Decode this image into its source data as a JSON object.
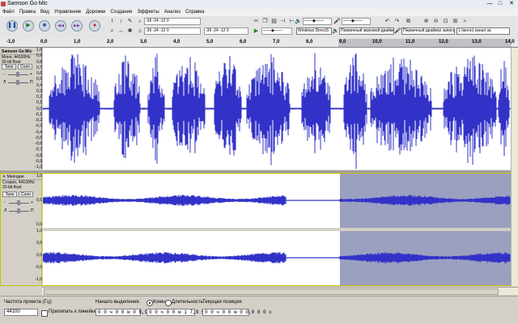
{
  "window": {
    "title": "Samson Go Mic",
    "minimize": "—",
    "maximize": "□",
    "close": "✕"
  },
  "menu": [
    "Файл",
    "Правка",
    "Вид",
    "Управление",
    "Дорожки",
    "Создание",
    "Эффекты",
    "Анализ",
    "Справка"
  ],
  "toolbar": {
    "pause": "❚❚",
    "play": "▶",
    "stop": "■",
    "skip_start": "◀◀",
    "skip_end": "▶▶",
    "record": "●",
    "meter_left_ticks": "-36  -24  -12   0",
    "meter_right_ticks": "-36  -24  -12   0",
    "host": "Windows DirectS",
    "output_device": "Первичный звуковой драйве",
    "input_device": "Первичный драйвер записи",
    "channels": "1 (моно) канал за"
  },
  "ruler": {
    "ticks": [
      "-1,0",
      "0,0",
      "1,0",
      "2,0",
      "3,0",
      "4,0",
      "5,0",
      "6,0",
      "7,0",
      "8,0",
      "9,0",
      "10,0",
      "11,0",
      "12,0",
      "13,0",
      "14,0"
    ]
  },
  "track1": {
    "name": "Samson Go Mic",
    "info1": "Моно, 44100Hz",
    "info2": "32-bit float",
    "mute": "Тихо",
    "solo": "Соло",
    "gain_minus": "-",
    "gain_plus": "+",
    "pan_left": "Л",
    "pan_right": "П",
    "scale": [
      "1,0",
      "0,9",
      "0,8",
      "0,7",
      "0,6",
      "0,5",
      "0,4",
      "0,3",
      "0,2",
      "0,1",
      "0,0",
      "-0,1",
      "-0,2",
      "-0,3",
      "-0,4",
      "-0,5",
      "-0,6",
      "-0,7",
      "-0,8",
      "-0,9",
      "-1,0"
    ]
  },
  "track2": {
    "name": "Мелодия",
    "close": "✕",
    "info1": "Стерео, 44100Hz",
    "info2": "32-bit float",
    "mute": "Тихо",
    "solo": "Соло",
    "gain_minus": "-",
    "gain_plus": "+",
    "pan_left": "Л",
    "pan_right": "П",
    "scale": [
      "1,0",
      "0,5",
      "0,0",
      "-0,5",
      "-1,0"
    ]
  },
  "bottom": {
    "rate_label": "Частота проекта (Гц):",
    "rate_value": "44100",
    "snap_label": "Прилипать к линейке",
    "sel_start_label": "Начало выделения:",
    "sel_start": "0 0 ч 0 0 м 0 8,9 9 4 с",
    "end_label": "Конец",
    "length_label": "Длительность",
    "sel_end": "0 0 ч 0 0 м 1 7,9 9 6 с",
    "pos_label": "Текущая позиция:",
    "pos": "0 0 ч 0 0 м 0 0,0 0 0 с"
  },
  "colors": {
    "wave": "#3232c8",
    "selection": "#9ca0c0",
    "track_bg": "#ffffff"
  }
}
